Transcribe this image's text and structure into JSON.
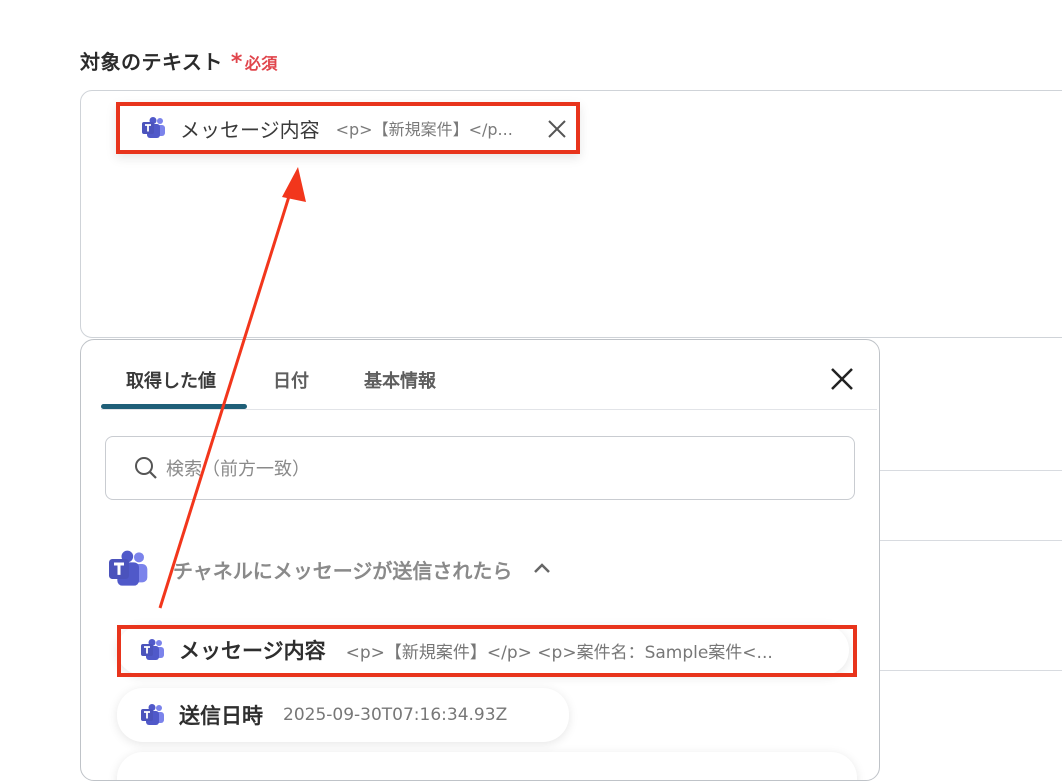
{
  "field": {
    "label": "対象のテキスト",
    "required_mark": "*",
    "required_text": "必須"
  },
  "selected_chip": {
    "icon": "teams-icon",
    "name": "メッセージ内容",
    "value": "<p>【新規案件】</p..."
  },
  "panel": {
    "tabs": [
      {
        "label": "取得した値",
        "active": true
      },
      {
        "label": "日付",
        "active": false
      },
      {
        "label": "基本情報",
        "active": false
      }
    ],
    "search": {
      "placeholder": "検索（前方一致）"
    },
    "group": {
      "icon": "teams-icon",
      "title": "チャネルにメッセージが送信されたら",
      "expanded": true
    },
    "items": [
      {
        "icon": "teams-icon",
        "name": "メッセージ内容",
        "value": "<p>【新規案件】</p> <p>案件名：Sample案件<..."
      },
      {
        "icon": "teams-icon",
        "name": "送信日時",
        "value": "2025-09-30T07:16:34.93Z"
      }
    ]
  },
  "colors": {
    "highlight": "#e8341c",
    "required": "#e0454c",
    "tab_underline": "#1f5f78",
    "teams_purple": "#5059c9"
  }
}
